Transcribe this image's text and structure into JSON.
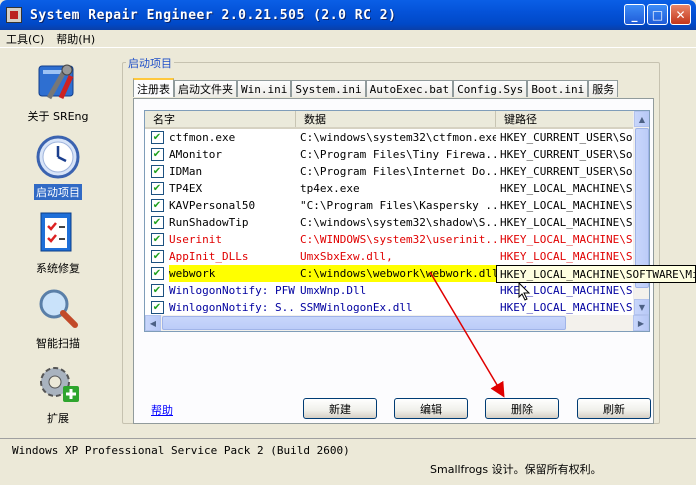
{
  "window": {
    "title": "System Repair Engineer 2.0.21.505 (2.0 RC 2)"
  },
  "menu": {
    "items": [
      "工具(C)",
      "帮助(H)"
    ]
  },
  "sidebar": {
    "items": [
      {
        "label": "关于 SREng",
        "icon": "about-tools-icon"
      },
      {
        "label": "启动项目",
        "icon": "clock-icon",
        "selected": true
      },
      {
        "label": "系统修复",
        "icon": "checklist-icon"
      },
      {
        "label": "智能扫描",
        "icon": "magnifier-icon"
      },
      {
        "label": "扩展",
        "icon": "gear-plus-icon"
      }
    ]
  },
  "group": {
    "title": "启动项目"
  },
  "tabs": [
    "注册表",
    "启动文件夹",
    "Win.ini",
    "System.ini",
    "AutoExec.bat",
    "Config.Sys",
    "Boot.ini",
    "服务"
  ],
  "list": {
    "columns": [
      "名字",
      "数据",
      "键路径"
    ],
    "rows": [
      {
        "name": "ctfmon.exe",
        "data": "C:\\windows\\system32\\ctfmon.exe",
        "key": "HKEY_CURRENT_USER\\Soft",
        "style": "normal"
      },
      {
        "name": "AMonitor",
        "data": "C:\\Program Files\\Tiny Firewa...",
        "key": "HKEY_CURRENT_USER\\Soft",
        "style": "normal"
      },
      {
        "name": "IDMan",
        "data": "C:\\Program Files\\Internet Do...",
        "key": "HKEY_CURRENT_USER\\Soft",
        "style": "normal"
      },
      {
        "name": "TP4EX",
        "data": "tp4ex.exe",
        "key": "HKEY_LOCAL_MACHINE\\Sof",
        "style": "normal"
      },
      {
        "name": "KAVPersonal50",
        "data": "\"C:\\Program Files\\Kaspersky ...",
        "key": "HKEY_LOCAL_MACHINE\\Sof",
        "style": "normal"
      },
      {
        "name": "RunShadowTip",
        "data": "C:\\windows\\system32\\shadow\\S...",
        "key": "HKEY_LOCAL_MACHINE\\Sof",
        "style": "normal"
      },
      {
        "name": "Userinit",
        "data": "C:\\WINDOWS\\system32\\userinit...",
        "key": "HKEY_LOCAL_MACHINE\\Sof",
        "style": "red"
      },
      {
        "name": "AppInit_DLLs",
        "data": "UmxSbxExw.dll,",
        "key": "HKEY_LOCAL_MACHINE\\Sof",
        "style": "red"
      },
      {
        "name": "webwork",
        "data": "C:\\windows\\webwork\\webwork.dll",
        "key": "HKEY_LOCAL_MACHINE\\Sof",
        "style": "highlight"
      },
      {
        "name": "WinlogonNotify: PFW",
        "data": "UmxWnp.Dll",
        "key": "HKEY_LOCAL_MACHINE\\SOF",
        "style": "blue"
      },
      {
        "name": "WinlogonNotify: S...",
        "data": "SSMWinlogonEx.dll",
        "key": "HKEY_LOCAL_MACHINE\\SOF",
        "style": "blue"
      }
    ]
  },
  "tooltip": {
    "text": "HKEY_LOCAL_MACHINE\\SOFTWARE\\Micro"
  },
  "buttons": {
    "help": "帮助",
    "new": "新建",
    "edit": "编辑",
    "delete": "删除",
    "refresh": "刷新"
  },
  "status": {
    "os": "Windows XP Professional Service Pack 2 (Build 2600)",
    "copyright": "Smallfrogs 设计。保留所有权利。"
  },
  "colors": {
    "title_bar": "#0452D8",
    "highlight": "#FFFF00",
    "red_text": "#E00000",
    "blue_text": "#0000A0",
    "arrow": "#E00000"
  }
}
